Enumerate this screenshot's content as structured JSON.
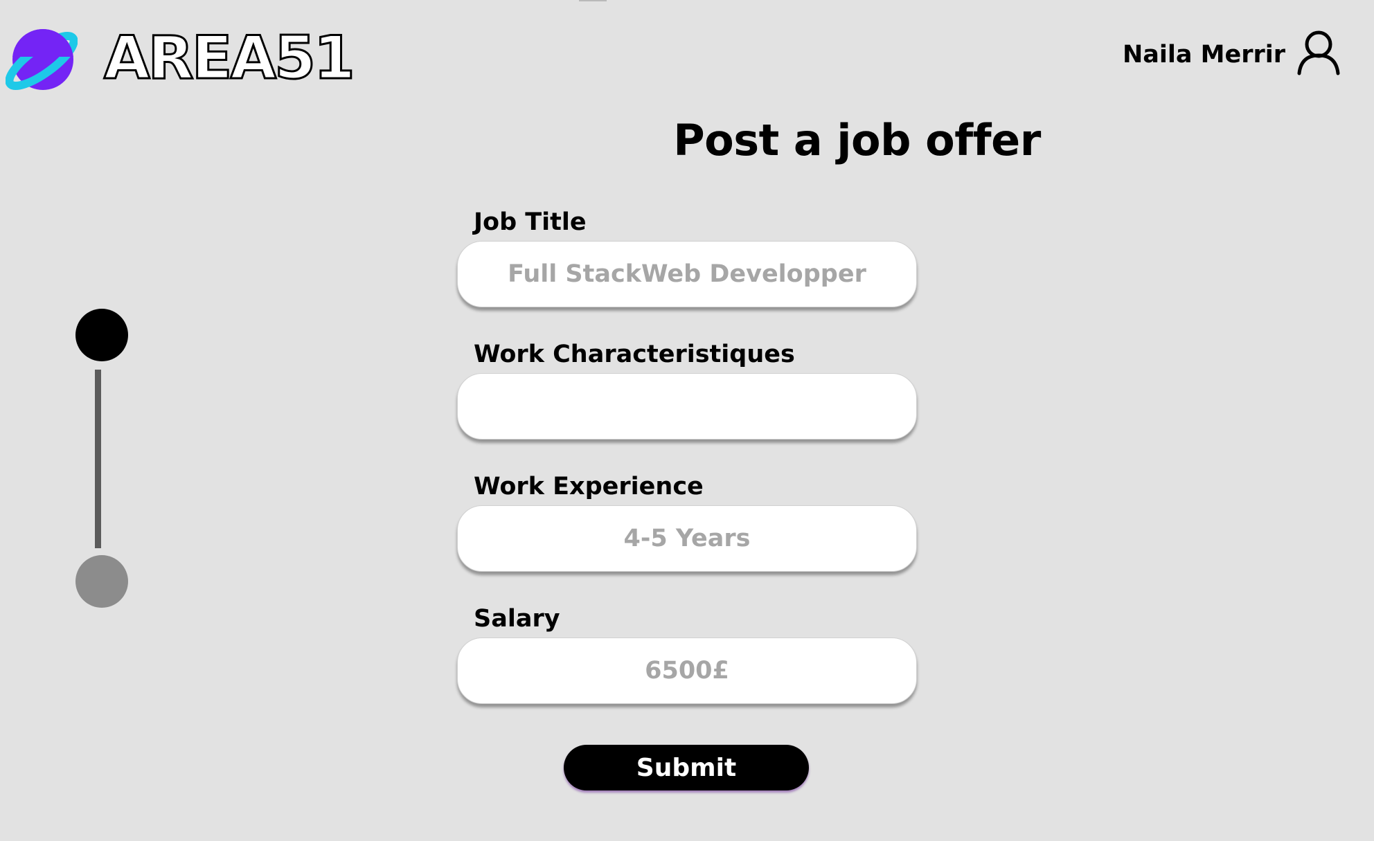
{
  "header": {
    "logo_text": "AREA51",
    "user_name": "Naila Merrir"
  },
  "page": {
    "title": "Post a job offer"
  },
  "stepper": {
    "total_steps": 2,
    "current_step": 1
  },
  "form": {
    "job_title": {
      "label": "Job Title",
      "placeholder": "Full StackWeb Developper"
    },
    "work_characteristics": {
      "label": "Work Characteristiques",
      "placeholder": ""
    },
    "work_experience": {
      "label": "Work Experience",
      "placeholder": "4-5 Years"
    },
    "salary": {
      "label": "Salary",
      "placeholder": "6500£"
    },
    "submit_label": "Submit"
  },
  "colors": {
    "background": "#e2e2e2",
    "logo_purple": "#7424f5",
    "logo_cyan": "#1ec9e8",
    "step_active": "#000000",
    "step_inactive": "#8c8c8c"
  },
  "icons": [
    "planet-logo-icon",
    "user-icon"
  ]
}
